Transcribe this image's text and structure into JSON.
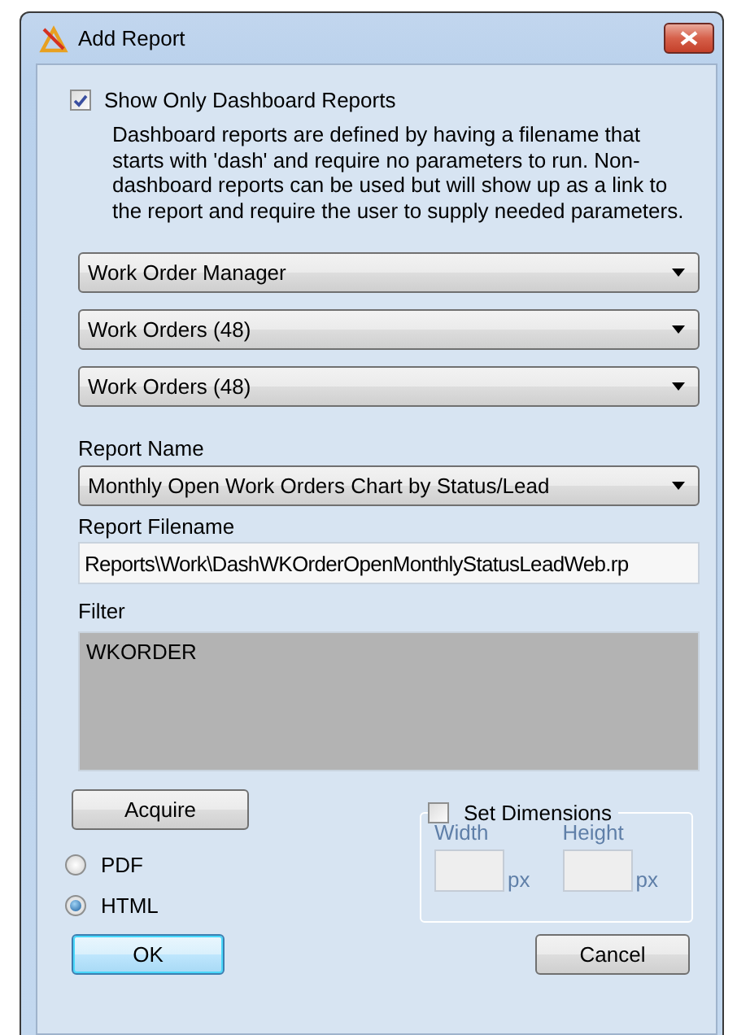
{
  "window": {
    "title": "Add Report"
  },
  "show_only_dashboard": {
    "label": "Show Only Dashboard Reports",
    "checked": true
  },
  "description": "Dashboard reports are defined by having a filename that starts with 'dash' and require no parameters to run. Non-dashboard reports can be used but will show up as a link to the report and require the user to supply needed parameters.",
  "selectors": [
    {
      "value": "Work Order Manager"
    },
    {
      "value": "Work Orders (48)"
    },
    {
      "value": "Work Orders (48)"
    }
  ],
  "report_name": {
    "label": "Report Name",
    "value": "Monthly Open Work Orders Chart by Status/Lead"
  },
  "report_filename": {
    "label": "Report Filename",
    "value": "Reports\\Work\\DashWKOrderOpenMonthlyStatusLeadWeb.rp"
  },
  "filter": {
    "label": "Filter",
    "value": "WKORDER"
  },
  "acquire_button": "Acquire",
  "formats": [
    {
      "label": "PDF",
      "selected": false
    },
    {
      "label": "HTML",
      "selected": true
    }
  ],
  "set_dimensions": {
    "label": "Set Dimensions",
    "checked": false,
    "width_label": "Width",
    "height_label": "Height",
    "width_unit": "px",
    "height_unit": "px"
  },
  "buttons": [
    {
      "label": "OK",
      "kind": "default"
    },
    {
      "label": "Cancel",
      "kind": "normal"
    }
  ]
}
